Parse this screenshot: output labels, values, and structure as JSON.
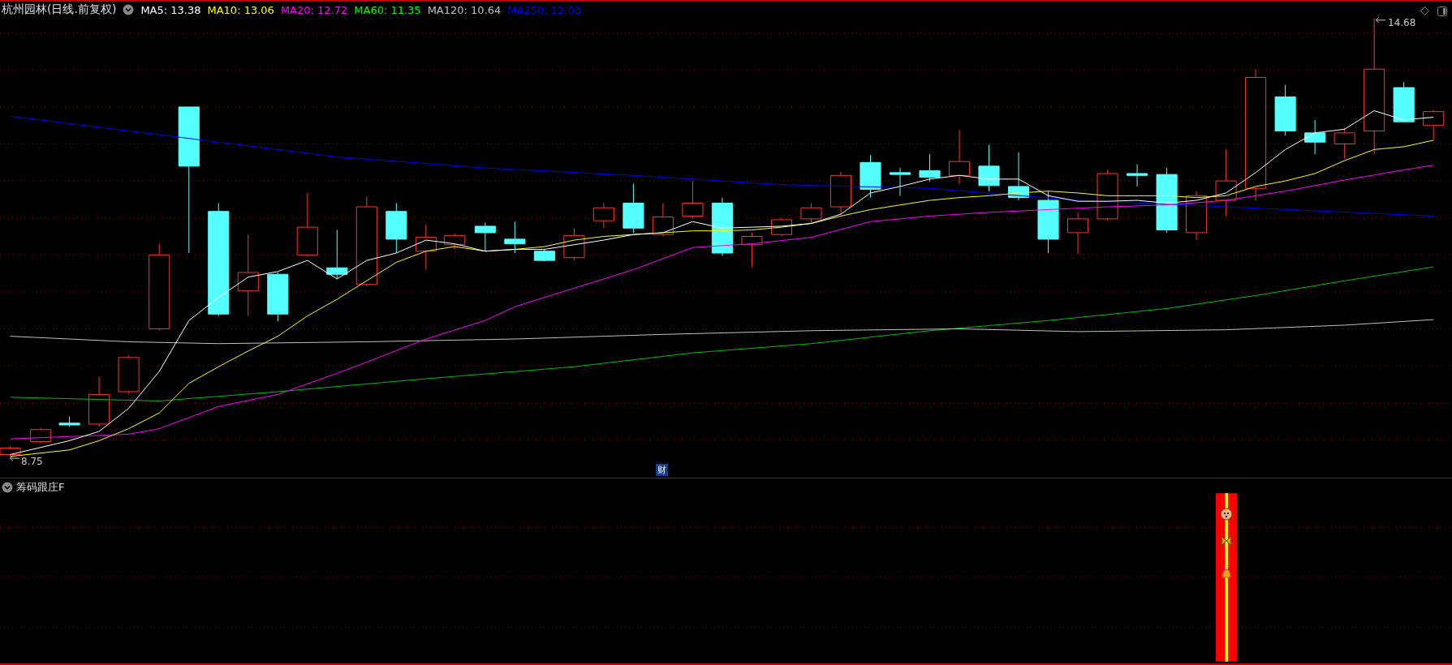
{
  "header": {
    "title": "杭州园林(日线.前复权)",
    "indicators": [
      {
        "label": "MA5: 13.38",
        "color": "#ffffff"
      },
      {
        "label": "MA10: 13.06",
        "color": "#ffff00"
      },
      {
        "label": "MA20: 12.72",
        "color": "#ff00ff"
      },
      {
        "label": "MA60: 11.35",
        "color": "#00ff00"
      },
      {
        "label": "MA120: 10.64",
        "color": "#c0c0c0"
      },
      {
        "label": "MA250: 12.03",
        "color": "#0000ff"
      }
    ]
  },
  "price_chart": {
    "high_label": "14.68",
    "low_label": "8.75",
    "badge": "财"
  },
  "lower_panel": {
    "title": "筹码跟庄F"
  }
}
